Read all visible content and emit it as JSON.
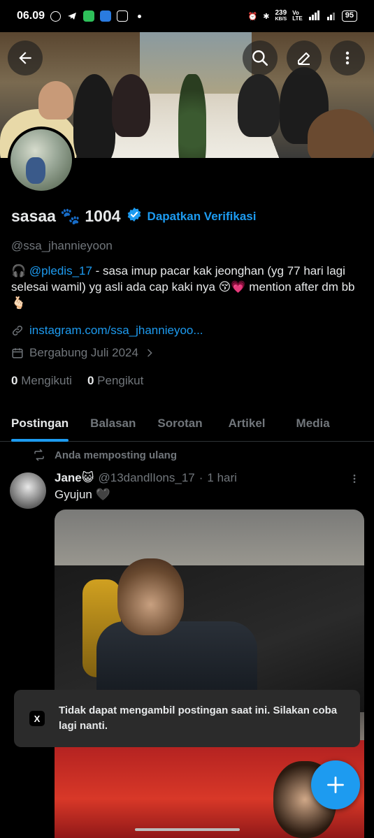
{
  "status_bar": {
    "time": "06.09",
    "speed": "239",
    "speed_unit": "KB/S",
    "network": "4G",
    "battery": "95"
  },
  "header": {
    "back_icon": "arrow-left-icon",
    "search_icon": "search-icon",
    "edit_icon": "edit-icon",
    "more_icon": "more-vertical-icon"
  },
  "profile": {
    "display_name": "sasaa 🐾 1004",
    "verify_cta": "Dapatkan Verifikasi",
    "handle": "@ssa_jhannieyoon",
    "bio_prefix": "🎧",
    "bio_mention": "@pledis_17",
    "bio_text": " -  sasa imup pacar kak jeonghan (yg 77 hari lagi selesai wamil) yg asli ada cap kaki nya 😚💗 mention after dm bb 🫰🏻",
    "link": "instagram.com/ssa_jhannieyoo...",
    "joined": "Bergabung Juli 2024",
    "following_count": "0",
    "following_label": "Mengikuti",
    "followers_count": "0",
    "followers_label": "Pengikut"
  },
  "tabs": [
    {
      "label": "Postingan"
    },
    {
      "label": "Balasan"
    },
    {
      "label": "Sorotan"
    },
    {
      "label": "Artikel"
    },
    {
      "label": "Media"
    }
  ],
  "post": {
    "repost_label": "Anda memposting ulang",
    "author_name": "Jane😺",
    "author_handle": "@13dandlIons_17",
    "separator": "·",
    "time": "1 hari",
    "text": "Gyujun 🖤"
  },
  "toast": {
    "message": "Tidak dapat mengambil postingan saat ini. Silakan coba lagi nanti.",
    "icon_letter": "X"
  },
  "colors": {
    "accent": "#1d9bf0",
    "background": "#000000",
    "muted": "#71767b",
    "text": "#e7e9ea"
  }
}
